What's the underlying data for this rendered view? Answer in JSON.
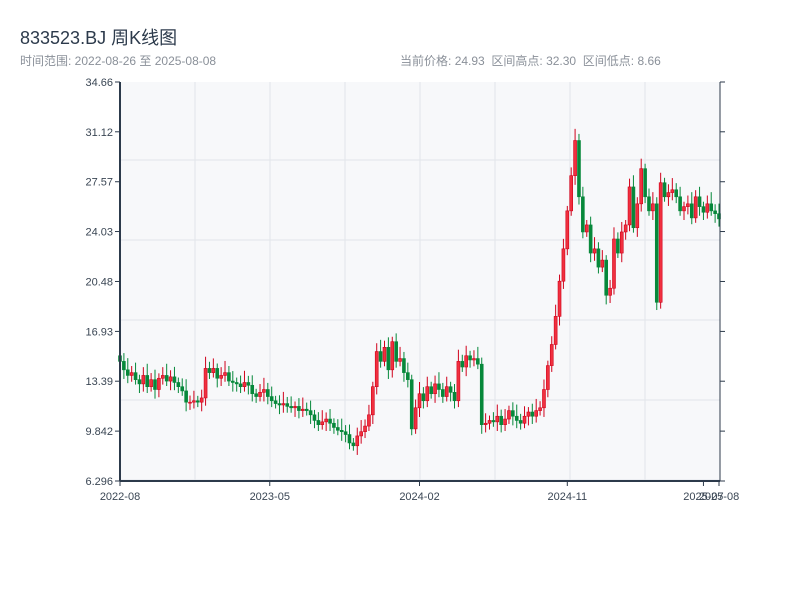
{
  "title": "833523.BJ 周K线图",
  "range_text": "时间范围: 2022-08-26 至 2025-08-08",
  "stats": {
    "current_label": "当前价格:",
    "current": "24.93",
    "high_label": "区间高点:",
    "high": "32.30",
    "low_label": "区间低点:",
    "low": "8.66"
  },
  "colors": {
    "up": "#d0021b",
    "down": "#06883a",
    "axis": "#2c3a4b",
    "grid": "#e2e5ea",
    "plot_bg": "#f7f8fa"
  },
  "chart_data": {
    "type": "candlestick",
    "frequency": "weekly",
    "start_date": "2022-08-26",
    "end_date": "2025-08-08",
    "ylim": [
      6.296,
      34.66
    ],
    "yticks": [
      "34.66",
      "31.12",
      "27.57",
      "24.03",
      "20.48",
      "16.93",
      "13.39",
      "9.842",
      "6.296"
    ],
    "xticks": [
      "2022-08",
      "2023-05",
      "2024-02",
      "2024-11",
      "2025-07",
      "2025-08"
    ],
    "grid": true,
    "first_open": 15.2,
    "closes": [
      14.8,
      14.2,
      13.8,
      14.0,
      13.5,
      13.2,
      13.8,
      13.0,
      13.5,
      12.8,
      13.6,
      13.8,
      13.4,
      13.7,
      13.3,
      13.0,
      12.7,
      11.9,
      11.9,
      12.0,
      11.9,
      12.2,
      14.3,
      14.0,
      14.3,
      13.6,
      13.8,
      14.0,
      13.4,
      13.3,
      13.2,
      13.0,
      13.3,
      13.1,
      12.5,
      12.3,
      12.6,
      12.8,
      12.3,
      12.0,
      11.8,
      11.7,
      11.8,
      11.6,
      11.5,
      11.6,
      11.3,
      11.4,
      11.3,
      11.0,
      10.6,
      10.3,
      10.5,
      10.7,
      10.4,
      10.1,
      9.9,
      9.8,
      9.6,
      9.0,
      8.8,
      9.5,
      9.8,
      10.2,
      11.0,
      13.0,
      15.5,
      14.8,
      15.8,
      14.2,
      16.2,
      14.8,
      15.0,
      14.0,
      13.5,
      10.0,
      11.5,
      12.5,
      12.0,
      13.0,
      12.5,
      13.2,
      12.8,
      12.3,
      13.0,
      12.6,
      12.0,
      14.8,
      14.4,
      15.2,
      14.9,
      15.0,
      14.6,
      10.3,
      10.4,
      10.6,
      10.5,
      10.9,
      10.3,
      10.7,
      11.3,
      10.9,
      10.6,
      10.4,
      10.9,
      11.2,
      10.9,
      11.3,
      11.5,
      12.8,
      14.5,
      16.0,
      18.0,
      20.5,
      22.8,
      25.5,
      28.0,
      30.5,
      26.5,
      24.0,
      24.5,
      22.5,
      22.8,
      21.5,
      22.0,
      19.5,
      20.0,
      23.5,
      22.5,
      24.0,
      24.5,
      27.2,
      24.3,
      26.0,
      28.5,
      26.5,
      25.5,
      26.0,
      19.0,
      27.5,
      26.5,
      26.8,
      27.0,
      26.5,
      25.5,
      25.8,
      26.0,
      25.0,
      26.5,
      25.8,
      25.4,
      26.0,
      25.5,
      25.3,
      24.93
    ]
  }
}
